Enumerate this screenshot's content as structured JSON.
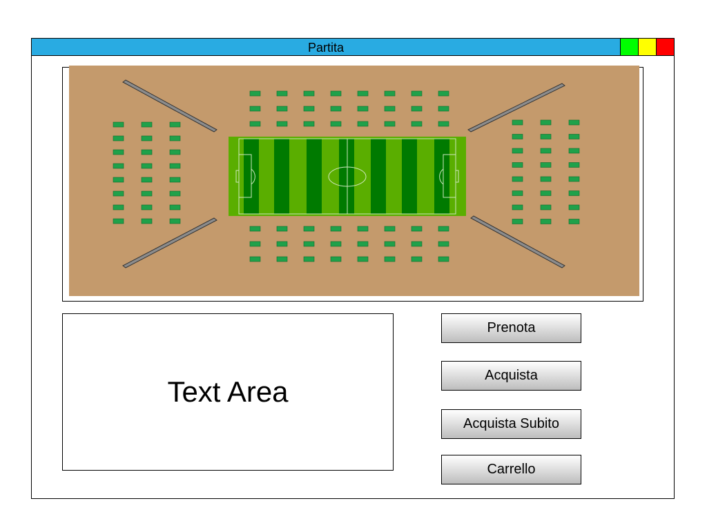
{
  "window": {
    "title": "Partita",
    "controls": [
      {
        "name": "minimize",
        "color": "#00ff00"
      },
      {
        "name": "maximize",
        "color": "#ffff00"
      },
      {
        "name": "close",
        "color": "#ff0000"
      }
    ]
  },
  "stadium_map": {
    "colors": {
      "ground": "#c49a6c",
      "seat": "#1fa14a",
      "pitch_light": "#5aae00",
      "pitch_dark": "#007a00",
      "ramp": "#8c8c8c"
    },
    "seat_blocks": [
      {
        "name": "seats-top",
        "rows": 3,
        "cols": 8
      },
      {
        "name": "seats-bottom",
        "rows": 3,
        "cols": 8
      },
      {
        "name": "seats-left",
        "rows": 8,
        "cols": 3
      },
      {
        "name": "seats-right",
        "rows": 8,
        "cols": 3
      }
    ]
  },
  "text_area": {
    "label": "Text Area"
  },
  "buttons": {
    "book": "Prenota",
    "buy": "Acquista",
    "buy_now": "Acquista Subito",
    "cart": "Carrello"
  }
}
